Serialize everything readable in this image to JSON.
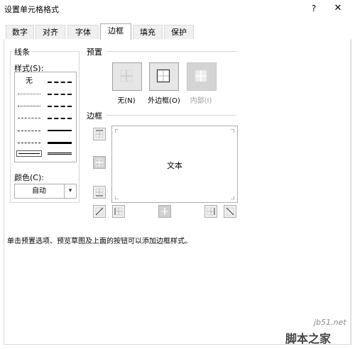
{
  "window": {
    "title": "设置单元格格式",
    "help": "?",
    "close": "✕"
  },
  "tabs": [
    {
      "label": "数字"
    },
    {
      "label": "对齐"
    },
    {
      "label": "字体"
    },
    {
      "label": "边框",
      "active": true
    },
    {
      "label": "填充"
    },
    {
      "label": "保护"
    }
  ],
  "line_group": {
    "title": "线条",
    "style_label": "样式(S):",
    "style_none": "无",
    "color_label": "颜色(C):",
    "color_value": "自动"
  },
  "presets": {
    "title": "预置",
    "none": "无(N)",
    "outline": "外边框(O)",
    "inside": "内部(I)"
  },
  "border": {
    "title": "边框",
    "preview_text": "文本"
  },
  "instruction": "单击预置选项、预览草图及上面的按钮可以添加边框样式。",
  "watermark": {
    "site": "jb51.net",
    "brand": "脚本之家"
  },
  "colors": {
    "accent": "#0078d7",
    "border": "#adadad",
    "disabled_text": "#9a9a9a"
  }
}
